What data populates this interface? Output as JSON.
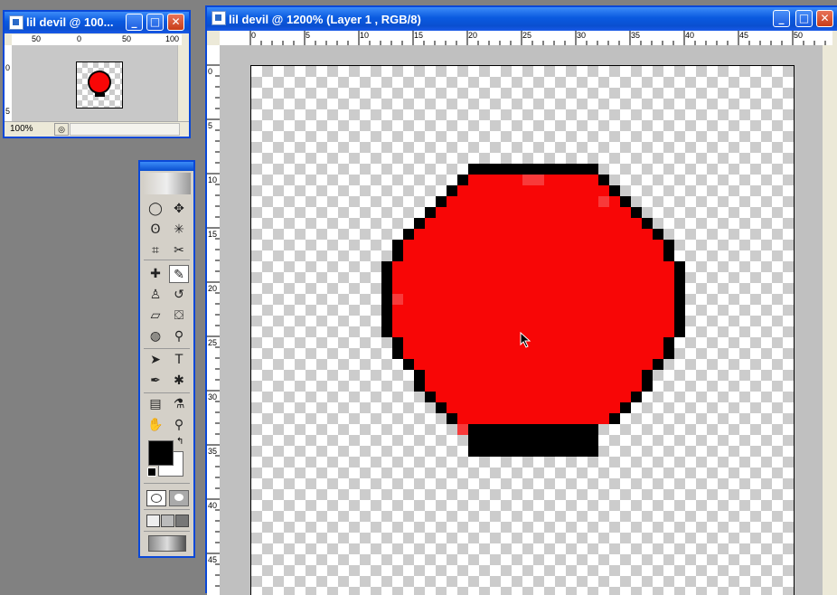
{
  "small_window": {
    "title": "lil devil @ 100...",
    "zoom": "100%",
    "ruler_h": [
      "50",
      "0",
      "50",
      "100"
    ],
    "ruler_v": [
      "0",
      "5"
    ]
  },
  "main_window": {
    "title": "lil devil @ 1200% (Layer 1 , RGB/8)",
    "ruler_h": [
      "0",
      "5",
      "10",
      "15",
      "20",
      "25",
      "30",
      "35",
      "40",
      "45",
      "50"
    ],
    "ruler_v": [
      "0",
      "5",
      "10",
      "15",
      "20",
      "25",
      "30",
      "35",
      "40",
      "45"
    ]
  },
  "window_buttons": {
    "minimize": "_",
    "maximize": "□",
    "close": "✕"
  },
  "toolbox": {
    "tools": [
      {
        "name": "marquee-tool-icon",
        "glyph": "◯"
      },
      {
        "name": "move-tool-icon",
        "glyph": "✥"
      },
      {
        "name": "lasso-tool-icon",
        "glyph": "ʘ"
      },
      {
        "name": "magic-wand-tool-icon",
        "glyph": "✳"
      },
      {
        "name": "crop-tool-icon",
        "glyph": "⌗"
      },
      {
        "name": "slice-tool-icon",
        "glyph": "✂"
      },
      {
        "name": "healing-brush-tool-icon",
        "glyph": "✚"
      },
      {
        "name": "brush-tool-icon",
        "glyph": "✎"
      },
      {
        "name": "clone-stamp-tool-icon",
        "glyph": "♙"
      },
      {
        "name": "history-brush-tool-icon",
        "glyph": "↺"
      },
      {
        "name": "eraser-tool-icon",
        "glyph": "▱"
      },
      {
        "name": "paint-bucket-tool-icon",
        "glyph": "⛋"
      },
      {
        "name": "blur-tool-icon",
        "glyph": "◍"
      },
      {
        "name": "dodge-tool-icon",
        "glyph": "⚲"
      },
      {
        "name": "path-selection-tool-icon",
        "glyph": "➤"
      },
      {
        "name": "type-tool-icon",
        "glyph": "T"
      },
      {
        "name": "pen-tool-icon",
        "glyph": "✒"
      },
      {
        "name": "shape-tool-icon",
        "glyph": "✱"
      },
      {
        "name": "notes-tool-icon",
        "glyph": "▤"
      },
      {
        "name": "eyedropper-tool-icon",
        "glyph": "⚗"
      },
      {
        "name": "hand-tool-icon",
        "glyph": "✋"
      },
      {
        "name": "zoom-tool-icon",
        "glyph": "⚲"
      }
    ],
    "foreground_color": "#000000",
    "background_color": "#ffffff"
  },
  "image": {
    "fill_color": "#f80606",
    "outline_color": "#000000",
    "highlight_color": "#f83a3a"
  }
}
